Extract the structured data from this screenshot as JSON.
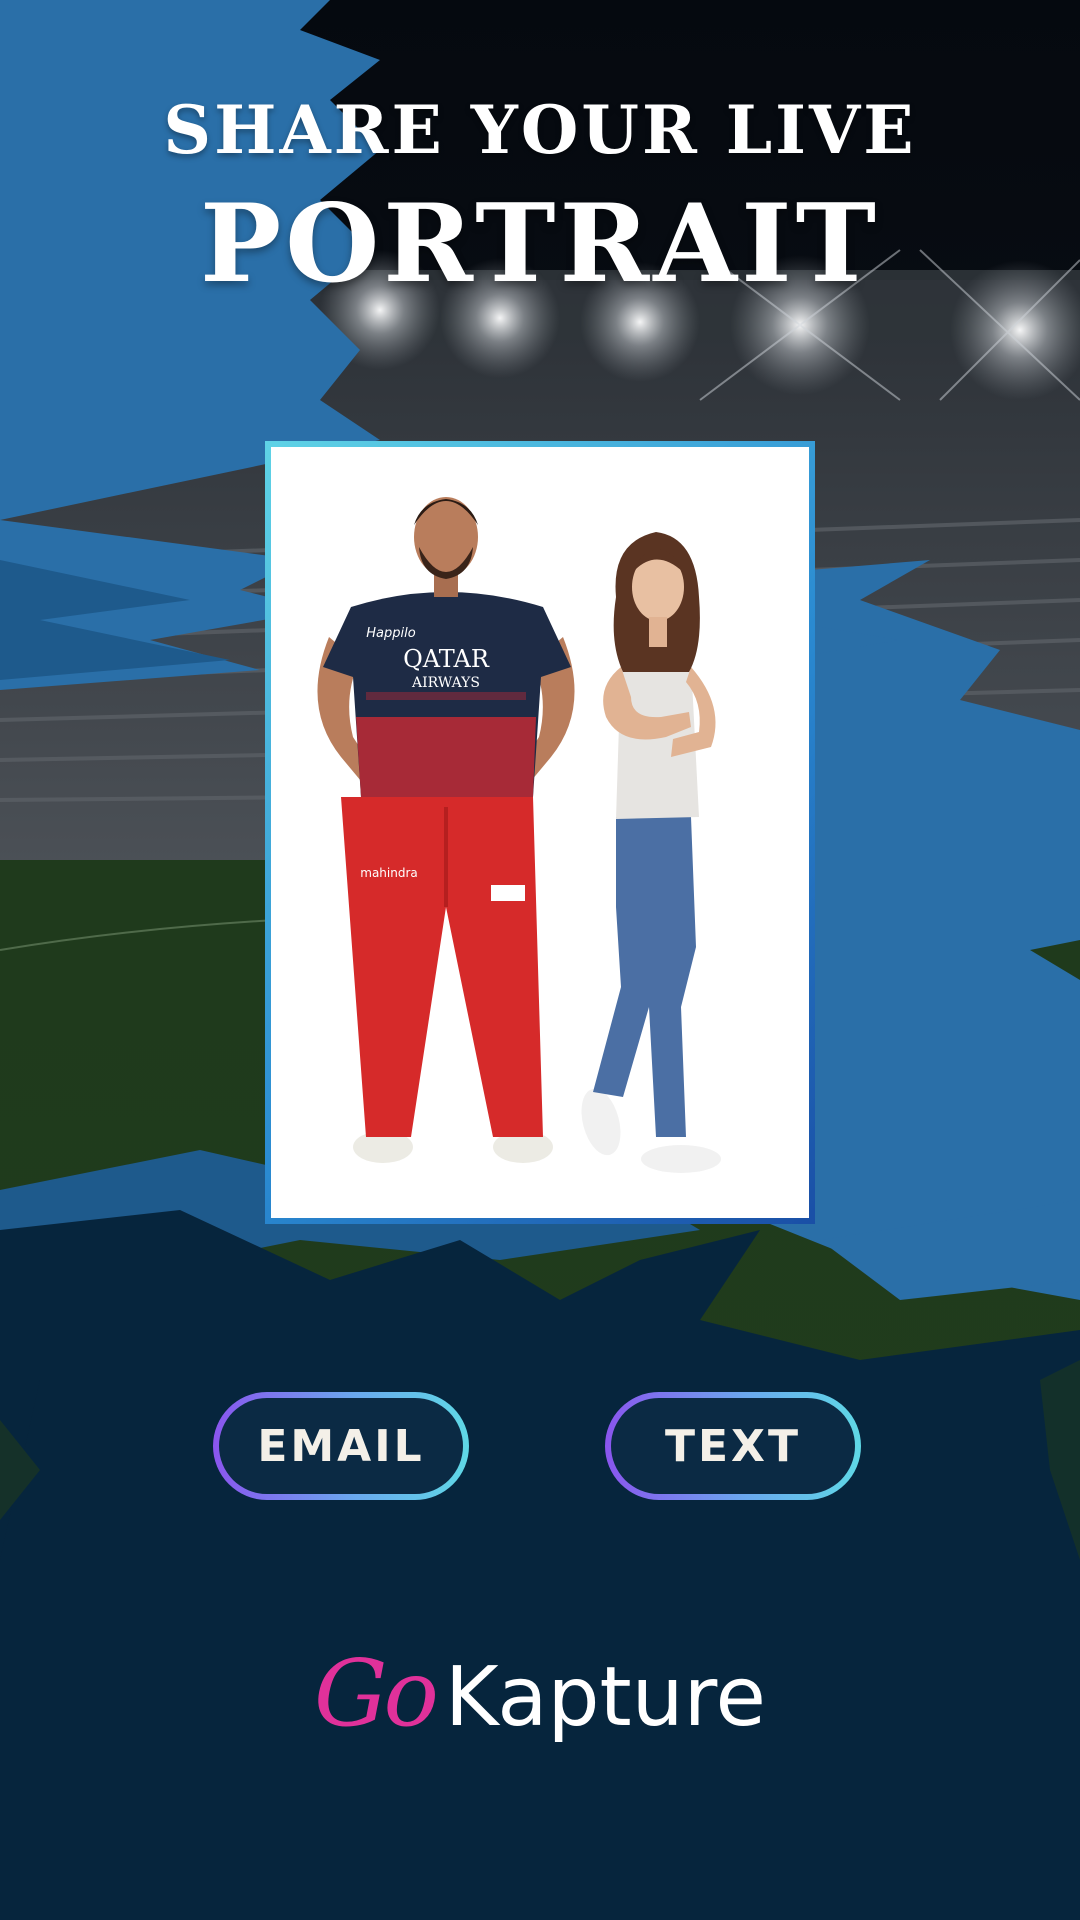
{
  "heading": {
    "line1": "SHARE YOUR LIVE",
    "line2": "PORTRAIT"
  },
  "photo": {
    "jersey_sponsor_line1": "QATAR",
    "jersey_sponsor_line2": "AIRWAYS",
    "jersey_chest_brand": "Happilo",
    "pants_brand": "mahindra"
  },
  "actions": {
    "email_label": "EMAIL",
    "text_label": "TEXT"
  },
  "logo": {
    "prefix": "Go",
    "name": "Kapture"
  },
  "colors": {
    "background_navy": "#06253d",
    "brush_blue": "#2a6fa8",
    "logo_pink": "#e0319a",
    "button_border_start": "#8a55ee",
    "button_border_end": "#5fd8e6",
    "frame_border": "#2a8ad1"
  }
}
